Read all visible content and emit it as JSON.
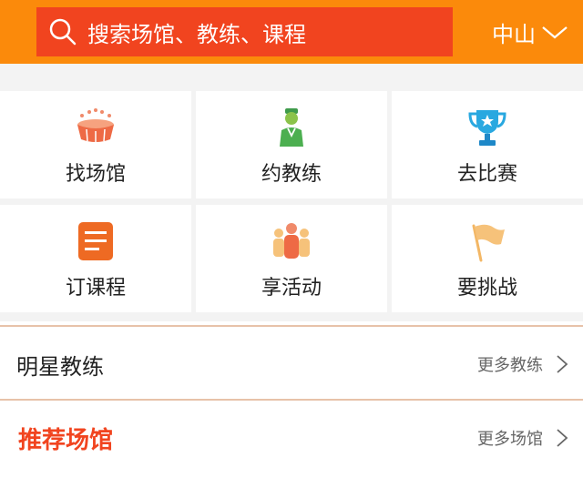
{
  "header": {
    "search_placeholder": "搜索场馆、教练、课程",
    "city": "中山"
  },
  "menu": [
    {
      "label": "找场馆",
      "icon": "stadium-icon"
    },
    {
      "label": "约教练",
      "icon": "coach-icon"
    },
    {
      "label": "去比赛",
      "icon": "trophy-icon"
    },
    {
      "label": "订课程",
      "icon": "course-list-icon"
    },
    {
      "label": "享活动",
      "icon": "group-people-icon"
    },
    {
      "label": "要挑战",
      "icon": "flag-icon"
    }
  ],
  "sections": {
    "star_coaches": {
      "title": "明星教练",
      "more": "更多教练"
    },
    "recommended_venues": {
      "title": "推荐场馆",
      "more": "更多场馆"
    }
  },
  "colors": {
    "header_bg": "#fb8a0b",
    "search_bg": "#f1441f",
    "accent": "#f1441f"
  }
}
